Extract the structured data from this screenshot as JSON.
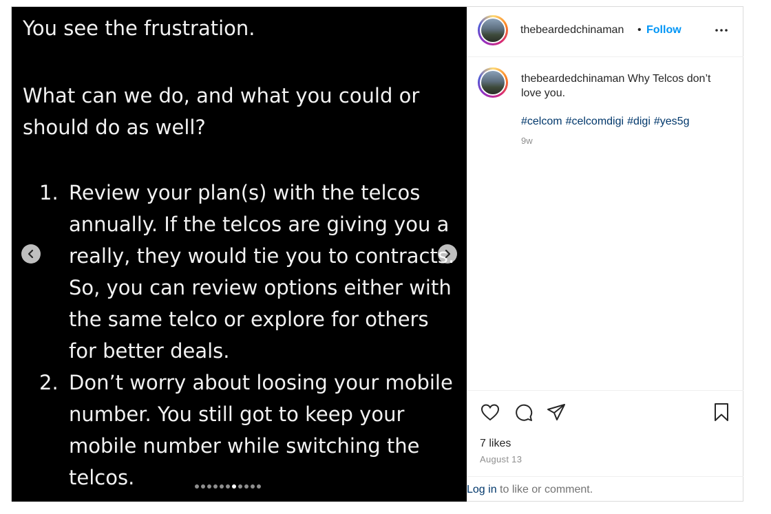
{
  "slide": {
    "line1": "You see the frustration.",
    "line2a": "What can we do, and what you could or",
    "line2b": "should do as well?",
    "items": [
      {
        "num": "1.",
        "lines": [
          "Review your plan(s) with the telcos",
          "annually.  If the telcos are giving you a",
          "really, they would tie you to contracts.",
          "So, you can review options either with",
          "the same telco or explore for others",
          "for better deals."
        ]
      },
      {
        "num": "2.",
        "lines": [
          "Don’t worry about loosing your mobile",
          "number.  You still got to keep your",
          "mobile number while switching the",
          "telcos."
        ]
      }
    ],
    "dots_total": 11,
    "dots_active": 6
  },
  "header": {
    "username": "thebeardedchinaman",
    "separator": "•",
    "follow_label": "Follow"
  },
  "caption": {
    "username": "thebeardedchinaman",
    "text": "Why Telcos don’t love you.",
    "hashtags": [
      "#celcom",
      "#celcomdigi",
      "#digi",
      "#yes5g"
    ],
    "age": "9w"
  },
  "actions": {
    "likes": "7 likes",
    "date": "August 13"
  },
  "login": {
    "link": "Log in",
    "rest": " to like or comment."
  },
  "icons": {
    "prev": "chevron-left-icon",
    "next": "chevron-right-icon",
    "more": "more-options-icon",
    "like": "heart-icon",
    "comment": "comment-icon",
    "share": "share-icon",
    "save": "bookmark-icon"
  },
  "colors": {
    "accent": "#0095f6",
    "hashtag": "#00376b",
    "media_bg": "#000000"
  }
}
